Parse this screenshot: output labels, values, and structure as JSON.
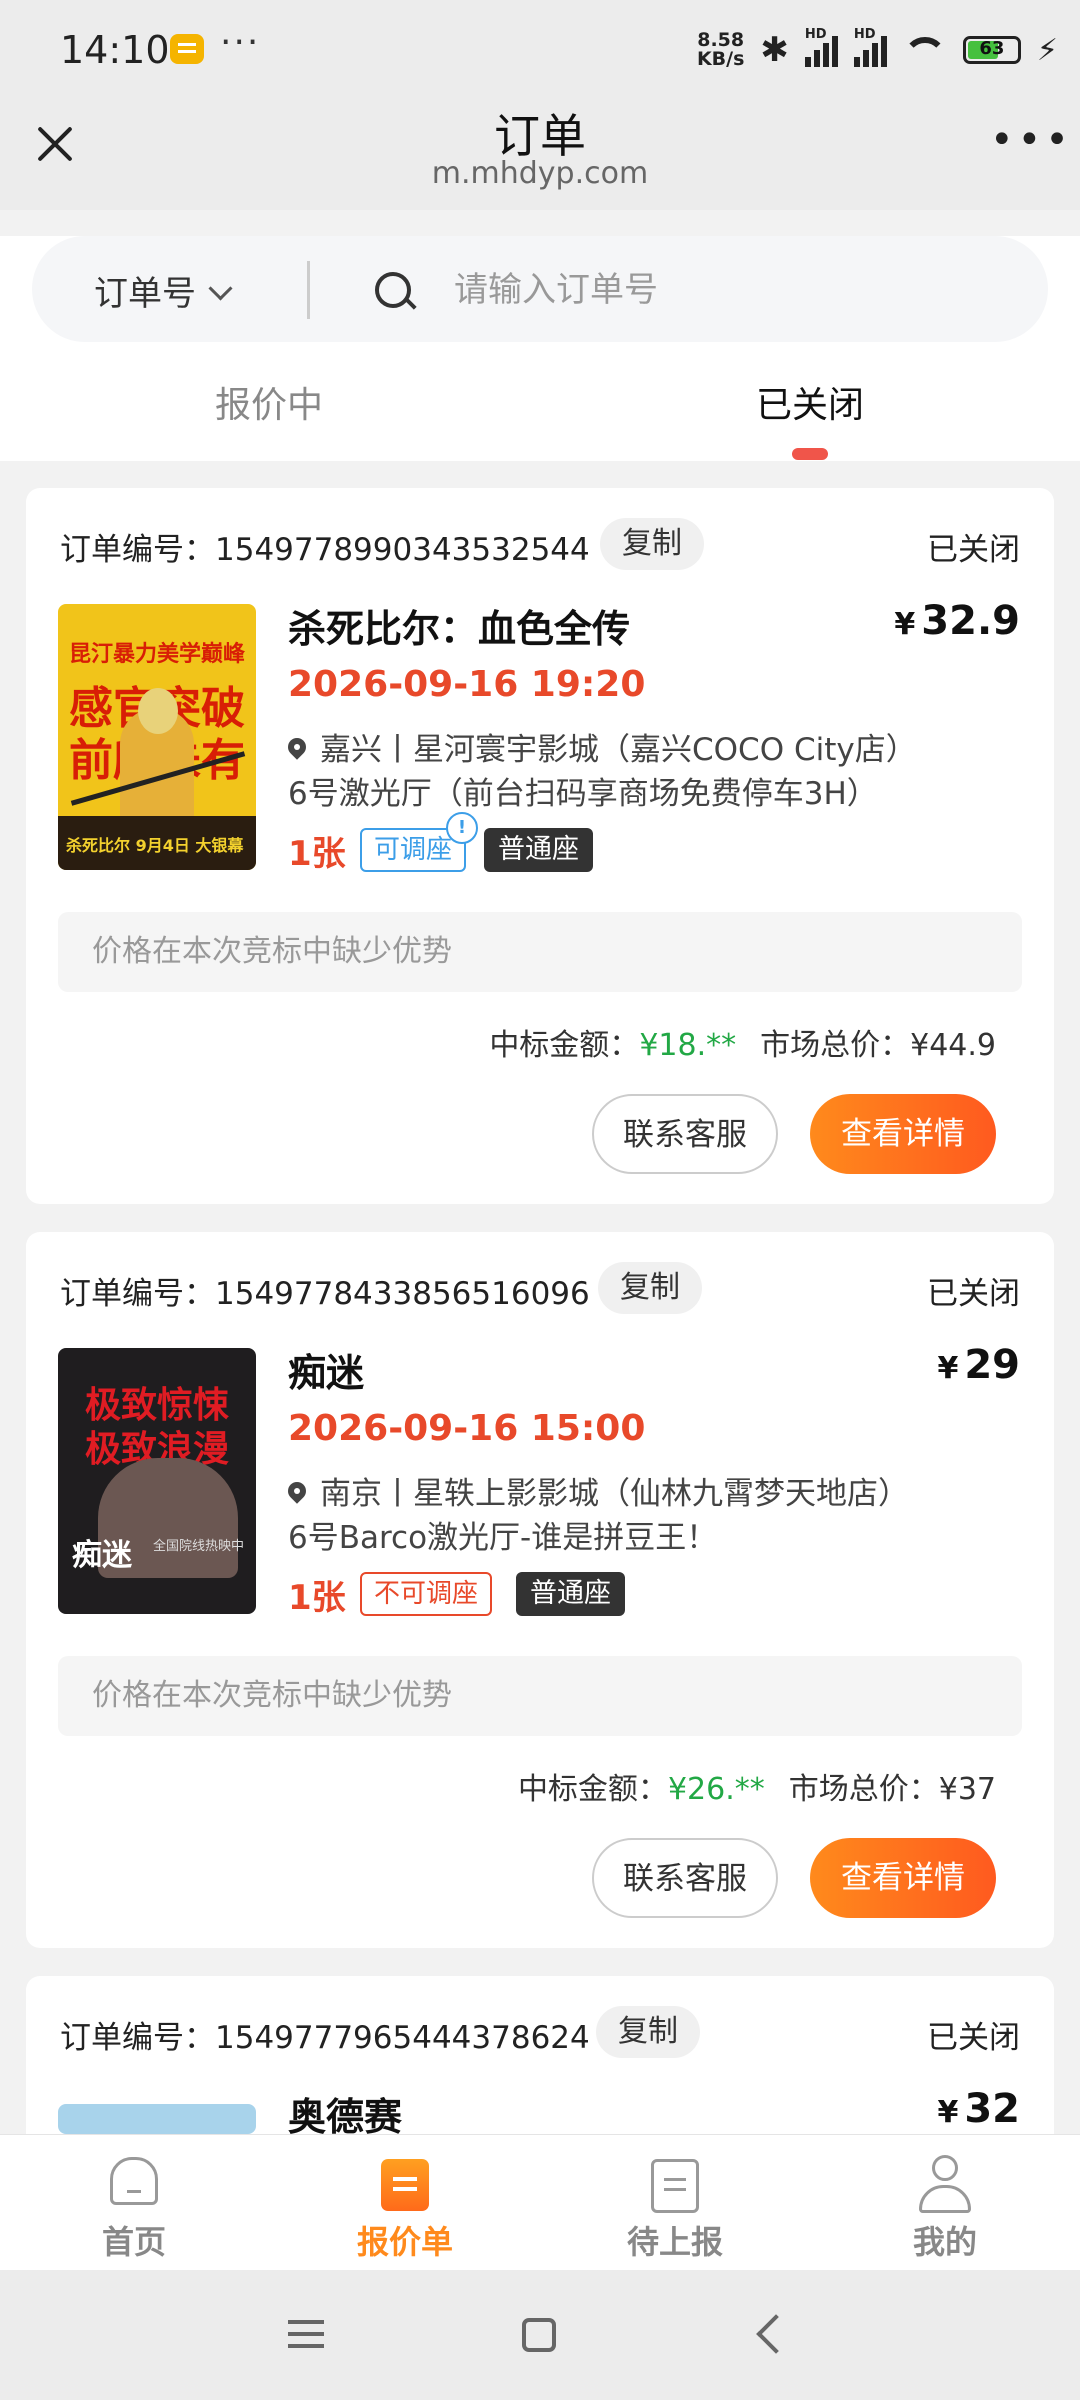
{
  "status_bar": {
    "time": "14:10",
    "net_speed_value": "8.58",
    "net_speed_unit": "KB/s",
    "signal_label": "HD",
    "battery_level": 63,
    "battery_text": "63"
  },
  "header": {
    "title": "订单",
    "url": "m.mhdyp.com"
  },
  "search": {
    "select_label": "订单号",
    "placeholder": "请输入订单号",
    "value": ""
  },
  "tabs": [
    {
      "label": "报价中",
      "active": false
    },
    {
      "label": "已关闭",
      "active": true
    }
  ],
  "orders": [
    {
      "order_prefix": "订单编号：",
      "order_no": "1549778990343532544",
      "copy_label": "复制",
      "status": "已关闭",
      "title": "杀死比尔：血色全传",
      "price_symbol": "¥",
      "price": "32.9",
      "showtime": "2026-09-16 19:20",
      "cinema": "嘉兴丨星河寰宇影城（嘉兴COCO City店）",
      "hall": "6号激光厅（前台扫码享商场免费停车3H）",
      "tickets": "1张",
      "seat_adjust": "可调座",
      "seat_adjust_allowed": true,
      "seat_type": "普通座",
      "notice": "价格在本次竞标中缺少优势",
      "win_label": "中标金额：",
      "win_amount": "¥18.**",
      "market_label": "市场总价：",
      "market_amount": "¥44.9",
      "contact_label": "联系客服",
      "detail_label": "查看详情",
      "poster": {
        "line1": "昆汀暴力美学巅峰",
        "line2": "感官突破",
        "line3": "前所未有",
        "bottom": "杀死比尔 9月4日 大银幕"
      }
    },
    {
      "order_prefix": "订单编号：",
      "order_no": "1549778433856516096",
      "copy_label": "复制",
      "status": "已关闭",
      "title": "痴迷",
      "price_symbol": "¥",
      "price": "29",
      "showtime": "2026-09-16 15:00",
      "cinema": "南京丨星轶上影影城（仙林九霄梦天地店）",
      "hall": "6号Barco激光厅-谁是拼豆王！",
      "tickets": "1张",
      "seat_adjust": "不可调座",
      "seat_adjust_allowed": false,
      "seat_type": "普通座",
      "notice": "价格在本次竞标中缺少优势",
      "win_label": "中标金额：",
      "win_amount": "¥26.**",
      "market_label": "市场总价：",
      "market_amount": "¥37",
      "contact_label": "联系客服",
      "detail_label": "查看详情",
      "poster": {
        "line1": "极致惊悚",
        "line2": "极致浪漫",
        "title": "痴迷",
        "subtitle": "全国院线热映中"
      }
    },
    {
      "order_prefix": "订单编号：",
      "order_no": "1549777965444378624",
      "copy_label": "复制",
      "status": "已关闭",
      "title": "奥德赛",
      "price_symbol": "¥",
      "price": "32"
    }
  ],
  "bottom_nav": [
    {
      "label": "首页",
      "icon": "home-icon",
      "active": false
    },
    {
      "label": "报价单",
      "icon": "quote-list-icon",
      "active": true
    },
    {
      "label": "待上报",
      "icon": "pending-report-icon",
      "active": false
    },
    {
      "label": "我的",
      "icon": "profile-icon",
      "active": false
    }
  ],
  "colors": {
    "accent": "#ff8a1c",
    "red": "#e8492a",
    "green": "#22a845",
    "blue": "#3c9ee8"
  }
}
